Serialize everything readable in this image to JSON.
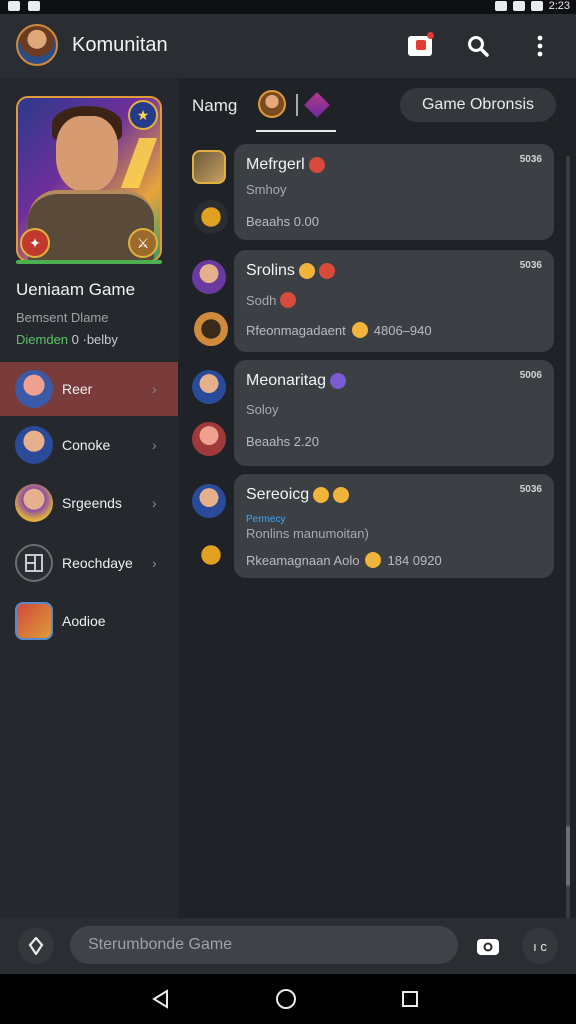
{
  "status_bar": {
    "time": "2:23"
  },
  "app_bar": {
    "title": "Komunitan",
    "icons": [
      "notification-icon",
      "search-icon",
      "more-vert-icon"
    ]
  },
  "sidebar": {
    "title": "Ueniaam Game",
    "subtitle": "Bemsent Dlame",
    "status_prefix": "Diemden",
    "status_suffix": " 0 ·belby",
    "items": [
      {
        "label": "Reer",
        "active": true
      },
      {
        "label": "Conoke",
        "active": false
      },
      {
        "label": "Srgeends",
        "active": false
      },
      {
        "label": "Reochdaye",
        "active": false
      },
      {
        "label": "Aodioe",
        "active": false
      }
    ]
  },
  "main": {
    "tab_label": "Namg",
    "pill_label": "Game Obronsis",
    "cards": [
      {
        "title": "Mefrgerl",
        "time": "5036",
        "sub": "Smhoy",
        "foot": "Beaahs 0.00"
      },
      {
        "title": "Srolins",
        "time": "5036",
        "sub": "Sodh",
        "foot": "Rfeonmagadaent",
        "foot_num": "4806–940"
      },
      {
        "title": "Meonaritag",
        "time": "5006",
        "sub": "Soloy",
        "foot": "Beaahs 2.20"
      },
      {
        "title": "Sereoicg",
        "time": "5036",
        "tag": "Permecy",
        "sub": "Ronlins  manumoitan)",
        "foot": "Rkeamagnaan Aolo",
        "foot_num": "184  0920"
      }
    ]
  },
  "composer": {
    "placeholder": "Sterumbonde Game",
    "right_label": "ı c"
  },
  "colors": {
    "accent_active": "#7a3b3b",
    "badge_green": "#5cc36a",
    "link_blue": "#42a5f5"
  }
}
